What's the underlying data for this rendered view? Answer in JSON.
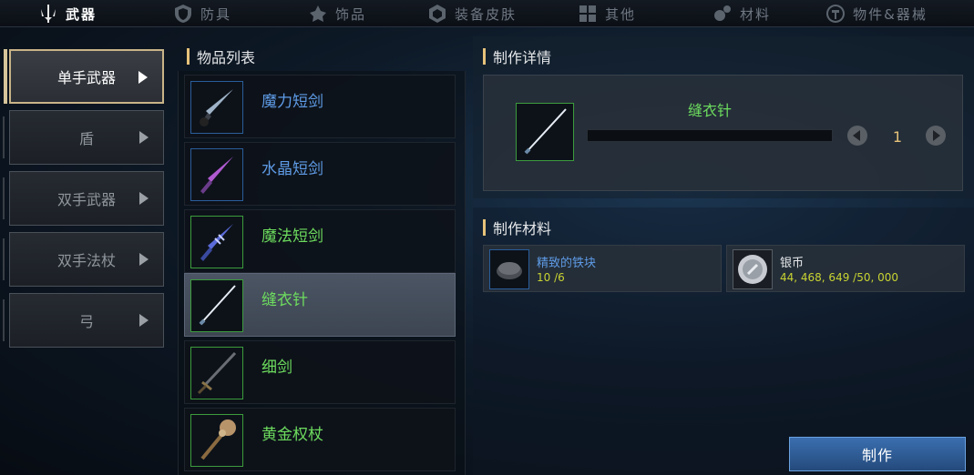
{
  "tabs": [
    {
      "label": "武器",
      "icon": "sword-icon",
      "active": true
    },
    {
      "label": "防具",
      "icon": "shield-icon",
      "active": false
    },
    {
      "label": "饰品",
      "icon": "amulet-icon",
      "active": false
    },
    {
      "label": "装备皮肤",
      "icon": "skin-icon",
      "active": false
    },
    {
      "label": "其他",
      "icon": "grid-icon",
      "active": false
    },
    {
      "label": "材料",
      "icon": "gears-icon",
      "active": false
    },
    {
      "label": "物件&器械",
      "icon": "hammer-icon",
      "active": false
    }
  ],
  "categories": [
    {
      "label": "单手武器",
      "active": true
    },
    {
      "label": "盾",
      "active": false
    },
    {
      "label": "双手武器",
      "active": false
    },
    {
      "label": "双手法杖",
      "active": false
    },
    {
      "label": "弓",
      "active": false
    }
  ],
  "item_list": {
    "title": "物品列表",
    "items": [
      {
        "name": "魔力短剑",
        "rarity": "blue",
        "icon": "mana-dagger-icon",
        "selected": false
      },
      {
        "name": "水晶短剑",
        "rarity": "blue",
        "icon": "crystal-dagger-icon",
        "selected": false
      },
      {
        "name": "魔法短剑",
        "rarity": "green",
        "icon": "magic-dagger-icon",
        "selected": false
      },
      {
        "name": "缝衣针",
        "rarity": "green",
        "icon": "needle-icon",
        "selected": true
      },
      {
        "name": "细剑",
        "rarity": "green",
        "icon": "rapier-icon",
        "selected": false
      },
      {
        "name": "黄金权杖",
        "rarity": "green",
        "icon": "golden-scepter-icon",
        "selected": false
      }
    ]
  },
  "detail": {
    "title": "制作详情",
    "item_name": "缝衣针",
    "quantity": "1"
  },
  "materials": {
    "title": "制作材料",
    "items": [
      {
        "name": "精致的铁块",
        "count": "10 /6",
        "icon": "iron-ingot-icon"
      },
      {
        "name": "银币",
        "count": "44, 468, 649 /50, 000",
        "icon": "silver-coin-icon"
      }
    ]
  },
  "craft_button": "制作",
  "colors": {
    "blue_rarity": "#5e9be6",
    "green_rarity": "#6ddc5e",
    "accent_gold": "#e6c27a",
    "count_yellow": "#c9d432",
    "button_blue": "#3b6fb0"
  }
}
